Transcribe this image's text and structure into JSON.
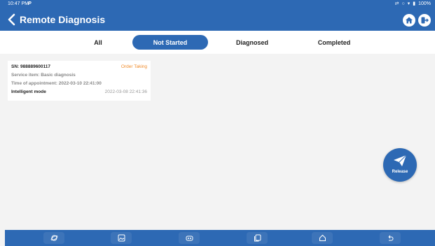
{
  "status_bar": {
    "time": "10:47 PM",
    "app_icon": "P",
    "battery": "100%"
  },
  "header": {
    "title": "Remote Diagnosis",
    "back_icon": "chevron-left-icon",
    "home_icon": "home-icon",
    "exit_icon": "exit-icon"
  },
  "tabs": [
    {
      "label": "All",
      "active": false
    },
    {
      "label": "Not Started",
      "active": true
    },
    {
      "label": "Diagnosed",
      "active": false
    },
    {
      "label": "Completed",
      "active": false
    }
  ],
  "orders": [
    {
      "sn": "SN: 988889600117",
      "status": "Order Taking",
      "service_item": "Service item: Basic diagnosis",
      "appointment": "Time of appointment: 2022-03-10 22:41:00",
      "mode": "Intelligent mode",
      "created": "2022-03-08 22:41:36"
    }
  ],
  "release_button": {
    "label": "Release",
    "icon": "paper-plane-icon"
  },
  "nav_bar": {
    "buttons": [
      "orbit-icon",
      "image-icon",
      "vci-icon",
      "recent-apps-icon",
      "home-icon",
      "back-icon"
    ]
  },
  "colors": {
    "primary": "#2d69b4",
    "accent_orange": "#f08b2a",
    "background": "#f3f3f3"
  }
}
